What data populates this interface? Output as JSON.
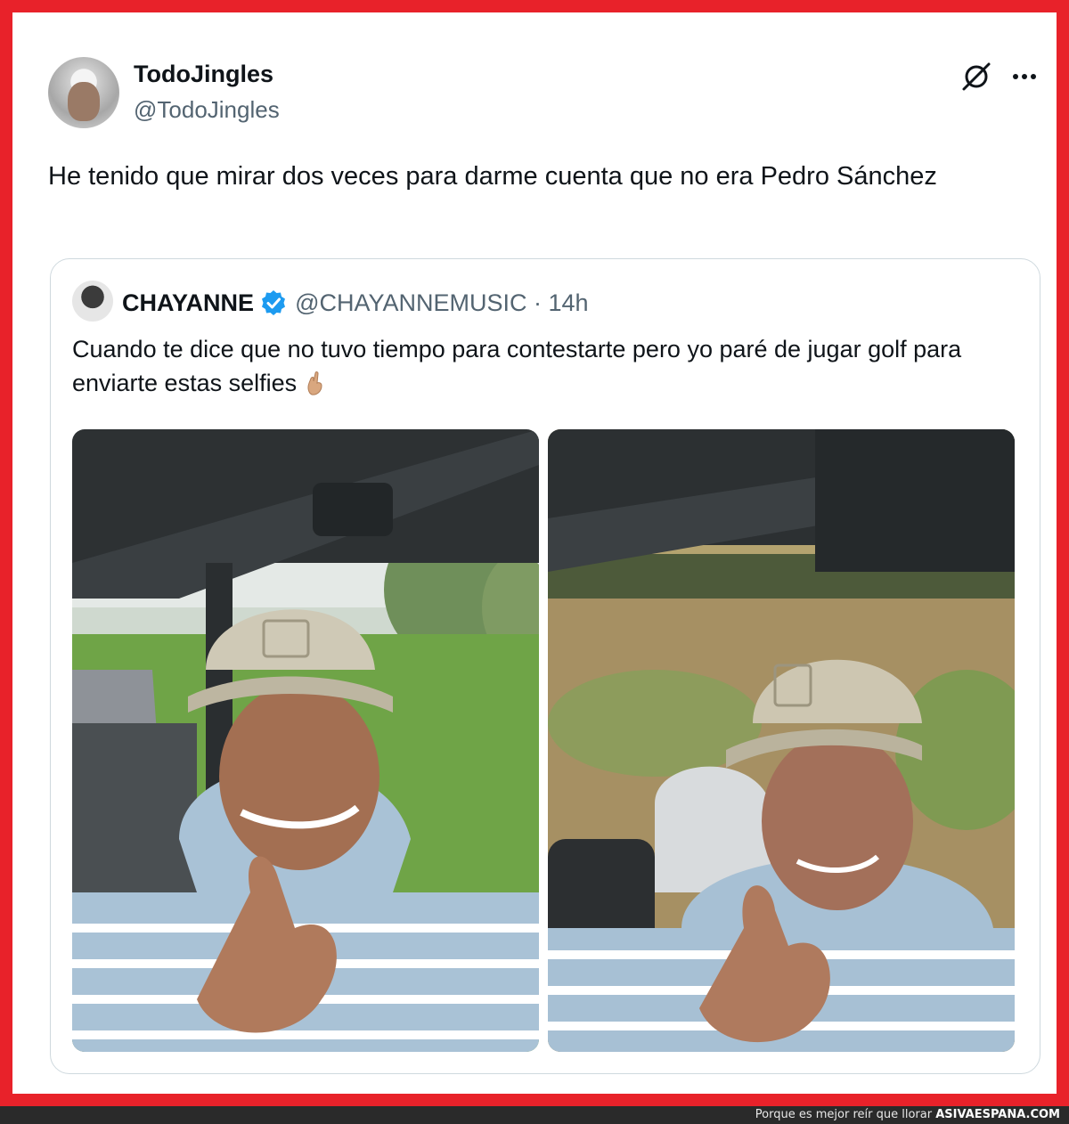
{
  "author": {
    "name": "TodoJingles",
    "handle": "@TodoJingles"
  },
  "tweet": {
    "text": "He tenido que mirar dos veces para darme cuenta que no era Pedro Sánchez"
  },
  "icons": {
    "header_right": [
      "x-slash-icon",
      "more-dots-icon"
    ],
    "verified": "verified-badge-icon",
    "emoji": "heart-hands-emoji-icon"
  },
  "quoted": {
    "name": "CHAYANNE",
    "handle_time": "@CHAYANNEMUSIC · 14h",
    "text": "Cuando te dice que no tuvo tiempo para contestarte pero yo paré de jugar golf para enviarte estas selfies",
    "photos": [
      "selfie-golf-cart-1",
      "selfie-golf-cart-2"
    ]
  },
  "footer": {
    "tagline": "Porque es mejor reír que llorar",
    "brand": "ASIVAESPANA.COM"
  },
  "colors": {
    "frame": "#e8222a",
    "verified": "#1d9bf0",
    "secondary_text": "#536471"
  }
}
